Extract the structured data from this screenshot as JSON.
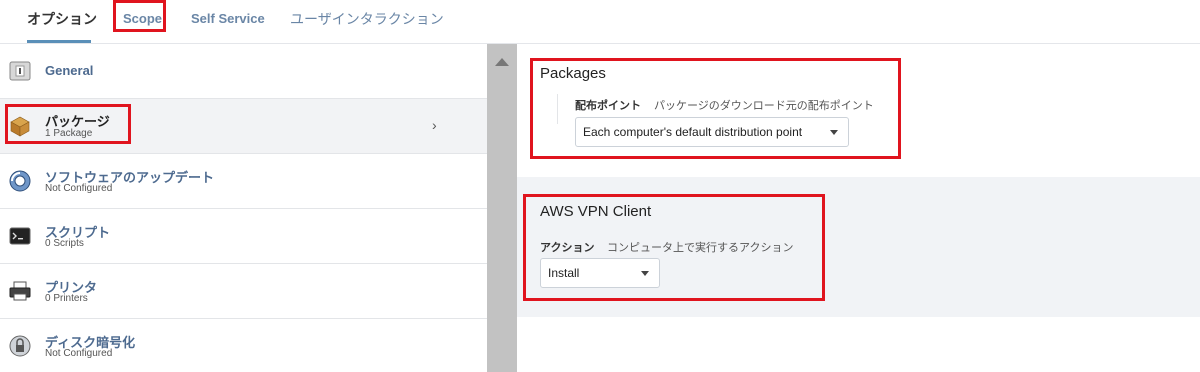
{
  "tabs": [
    {
      "label": "オプション"
    },
    {
      "label": "Scope"
    },
    {
      "label": "Self Service"
    },
    {
      "label": "ユーザインタラクション"
    }
  ],
  "sidebar": {
    "items": [
      {
        "title": "General",
        "subtitle": "",
        "icon": "general-icon"
      },
      {
        "title": "パッケージ",
        "subtitle": "1 Package",
        "icon": "package-icon"
      },
      {
        "title": "ソフトウェアのアップデート",
        "subtitle": "Not Configured",
        "icon": "software-update-icon"
      },
      {
        "title": "スクリプト",
        "subtitle": "0 Scripts",
        "icon": "terminal-icon"
      },
      {
        "title": "プリンタ",
        "subtitle": "0 Printers",
        "icon": "printer-icon"
      },
      {
        "title": "ディスク暗号化",
        "subtitle": "Not Configured",
        "icon": "disk-encryption-icon"
      }
    ],
    "chevron": "›"
  },
  "packages": {
    "heading": "Packages",
    "distribution_label": "配布ポイント",
    "distribution_desc": "パッケージのダウンロード元の配布ポイント",
    "distribution_value": "Each computer's default distribution point"
  },
  "package_item": {
    "name": "AWS VPN Client",
    "action_label": "アクション",
    "action_desc": "コンピュータ上で実行するアクション",
    "action_value": "Install"
  },
  "colors": {
    "accent": "#5a8fb8",
    "highlight_box": "#e0141e",
    "sidebar_title": "#4d6a8f"
  }
}
